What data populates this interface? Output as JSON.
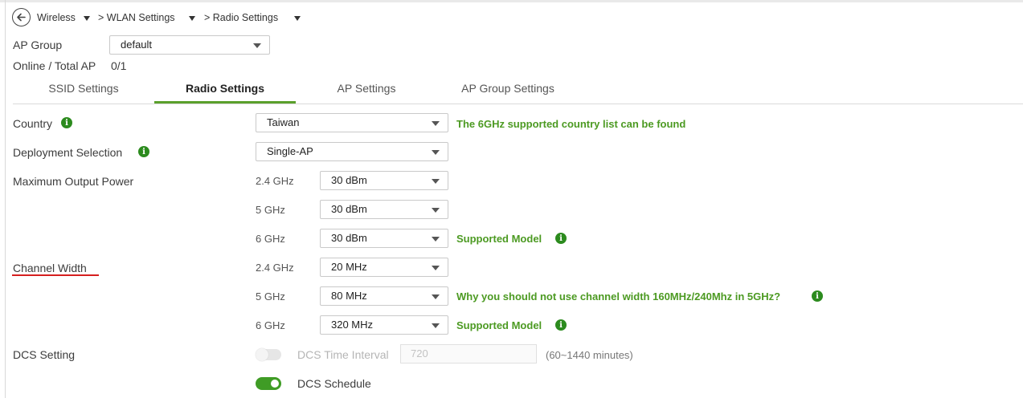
{
  "breadcrumb": {
    "items": [
      "Wireless",
      "> WLAN Settings",
      "> Radio Settings"
    ]
  },
  "ap_group": {
    "label": "AP Group",
    "value": "default",
    "online_label": "Online / Total AP",
    "online_value": "0/1"
  },
  "tabs": [
    {
      "label": "SSID Settings",
      "active": false
    },
    {
      "label": "Radio Settings",
      "active": true
    },
    {
      "label": "AP Settings",
      "active": false
    },
    {
      "label": "AP Group Settings",
      "active": false
    }
  ],
  "form": {
    "country": {
      "label": "Country",
      "value": "Taiwan",
      "link": "The 6GHz supported country list can be found"
    },
    "deployment": {
      "label": "Deployment Selection",
      "value": "Single-AP"
    },
    "max_power": {
      "label": "Maximum Output Power",
      "bands": [
        {
          "band": "2.4 GHz",
          "value": "30 dBm"
        },
        {
          "band": "5 GHz",
          "value": "30 dBm"
        },
        {
          "band": "6 GHz",
          "value": "30 dBm",
          "link": "Supported Model"
        }
      ]
    },
    "channel_width": {
      "label": "Channel Width",
      "bands": [
        {
          "band": "2.4 GHz",
          "value": "20 MHz"
        },
        {
          "band": "5 GHz",
          "value": "80 MHz",
          "link": "Why you should not use channel width 160MHz/240Mhz in 5GHz?"
        },
        {
          "band": "6 GHz",
          "value": "320 MHz",
          "link": "Supported Model"
        }
      ]
    },
    "dcs": {
      "label": "DCS Setting",
      "interval_label": "DCS Time Interval",
      "interval_value": "720",
      "interval_hint": "(60~1440 minutes)",
      "interval_enabled": false,
      "schedule_label": "DCS Schedule",
      "schedule_enabled": true
    }
  },
  "colors": {
    "accent": "#5aa02c",
    "link": "#4c9a22",
    "annotation": "#d61f1f"
  },
  "icons": {
    "back": "back-arrow-icon",
    "info": "info-icon",
    "dropdown": "chevron-down-icon"
  }
}
